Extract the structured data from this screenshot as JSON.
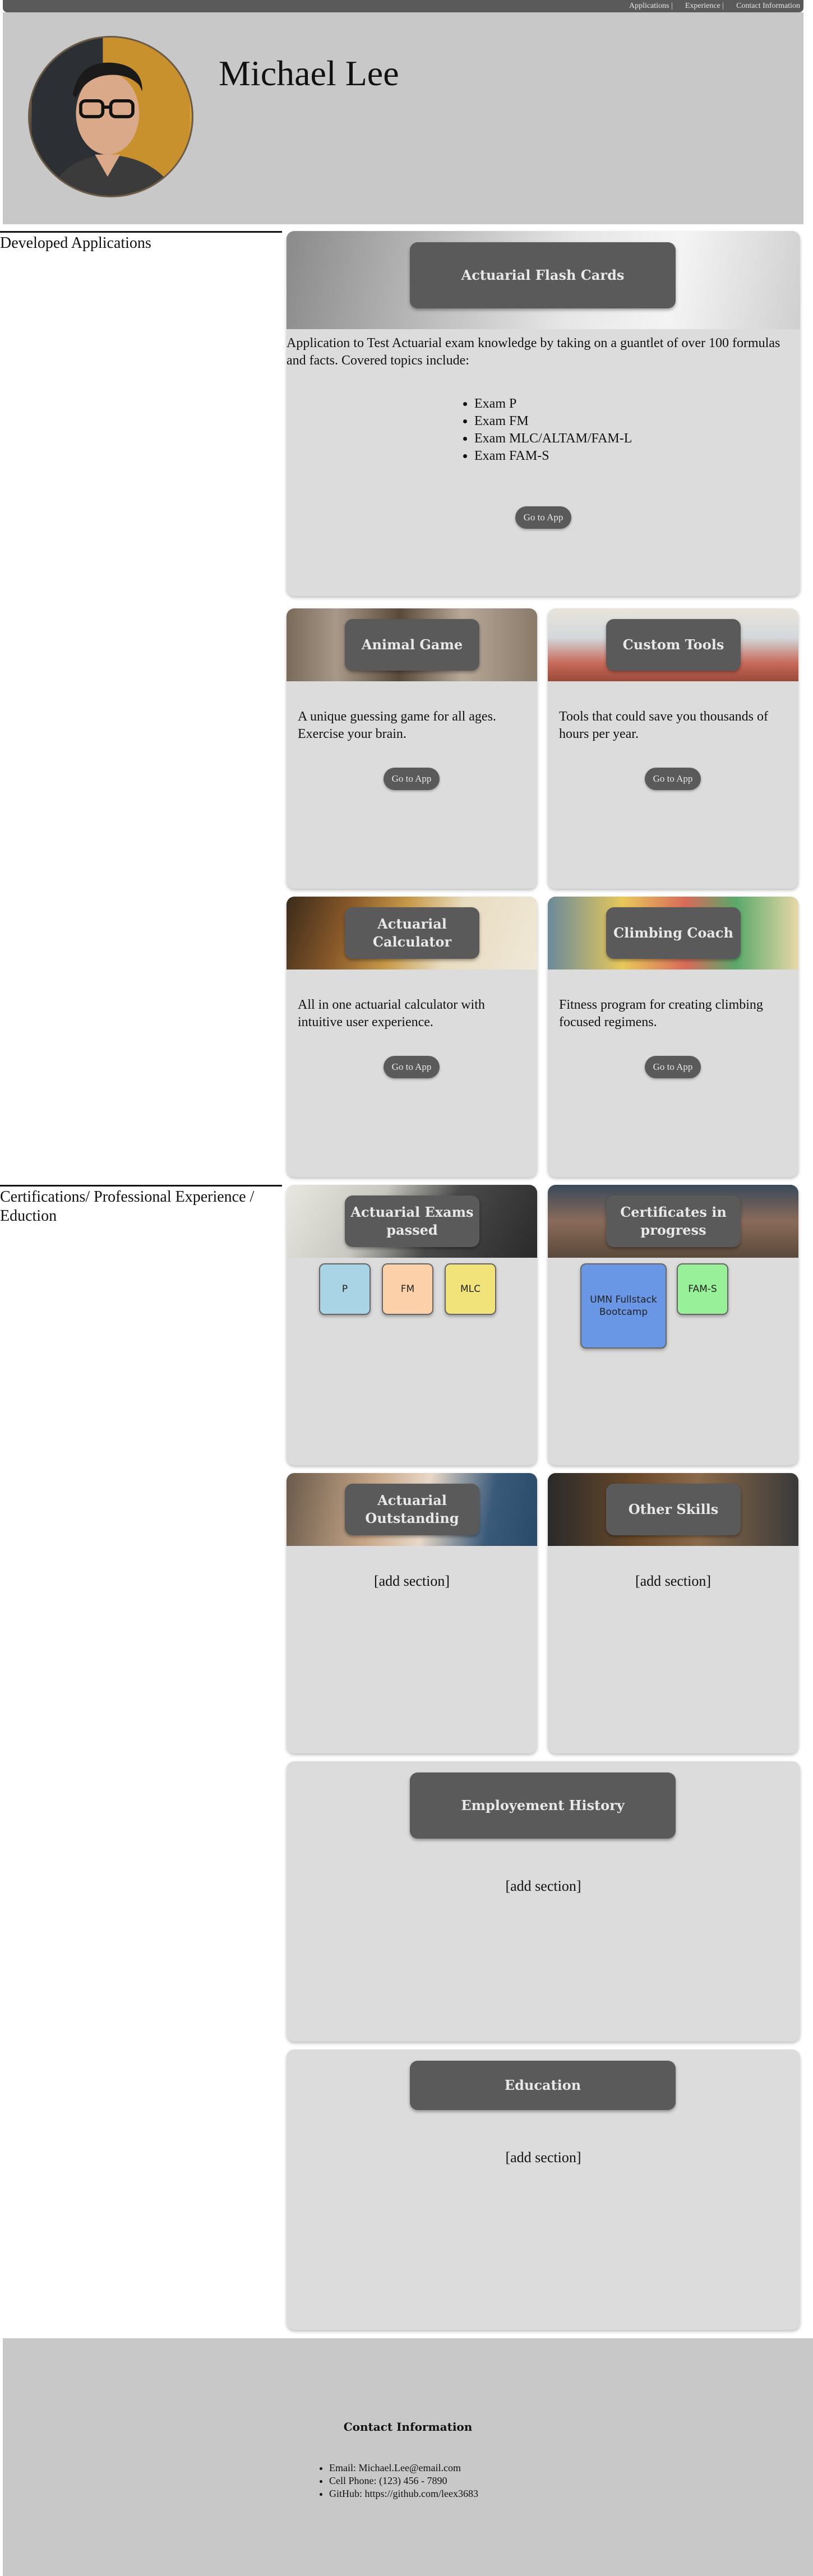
{
  "nav": {
    "links": [
      "Applications |",
      "Experience |",
      "Contact Information"
    ]
  },
  "header": {
    "name": "Michael Lee"
  },
  "sections": {
    "applications_label": "Developed Applications",
    "certifications_label": "Certifications/ Professional Experience / Eduction"
  },
  "apps": {
    "flash_cards": {
      "title": "Actuarial Flash Cards",
      "description": "Application to Test Actuarial exam knowledge by taking on a guantlet of over 100 formulas and facts. Covered topics include:",
      "topics": [
        "Exam P",
        "Exam FM",
        "Exam MLC/ALTAM/FAM-L",
        "Exam FAM-S"
      ],
      "button": "Go to App"
    },
    "animal_game": {
      "title": "Animal Game",
      "description": "A unique guessing game for all ages. Exercise your brain.",
      "button": "Go to App"
    },
    "custom_tools": {
      "title": "Custom Tools",
      "description": "Tools that could save you thousands of hours per year.",
      "button": "Go to App"
    },
    "calculator": {
      "title": "Actuarial Calculator",
      "description": "All in one actuarial calculator with intuitive user experience.",
      "button": "Go to App"
    },
    "climbing": {
      "title": "Climbing Coach",
      "description": "Fitness program for creating climbing focused regimens.",
      "button": "Go to App"
    }
  },
  "experience": {
    "exams_passed": {
      "title": "Actuarial Exams passed",
      "badges": [
        {
          "label": "P",
          "color": "#a8d4e6"
        },
        {
          "label": "FM",
          "color": "#fcd0a8"
        },
        {
          "label": "MLC",
          "color": "#f2e27a"
        }
      ]
    },
    "certs_progress": {
      "title": "Certificates in progress",
      "badges": [
        {
          "label": "UMN Fullstack Bootcamp",
          "color": "#6a96e6"
        },
        {
          "label": "FAM-S",
          "color": "#98f098"
        }
      ]
    },
    "outstanding": {
      "title": "Actuarial Outstanding",
      "placeholder": "[add section]"
    },
    "other_skills": {
      "title": "Other Skills",
      "placeholder": "[add section]"
    },
    "employment": {
      "title": "Employement History",
      "placeholder": "[add section]"
    },
    "education": {
      "title": "Education",
      "placeholder": "[add section]"
    }
  },
  "footer": {
    "title": "Contact Information",
    "items": [
      "Email: Michael.Lee@email.com",
      "Cell Phone: (123) 456 - 7890",
      "GitHub: https://github.com/leex3683"
    ]
  },
  "colors": {
    "card_bg": "#dcdcdc",
    "title_box": "#5a5a5a",
    "header_bg": "#c8c8c8"
  }
}
